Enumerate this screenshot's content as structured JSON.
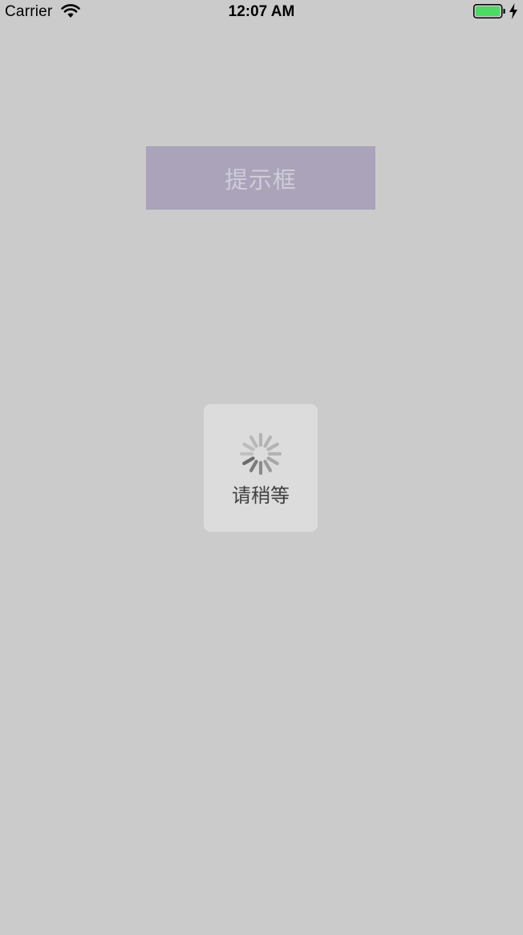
{
  "status_bar": {
    "carrier": "Carrier",
    "time": "12:07 AM",
    "wifi_icon": "wifi-icon",
    "battery_icon": "battery-icon",
    "charging_icon": "charging-bolt-icon",
    "battery_color": "#4cd964"
  },
  "main": {
    "prompt_button_label": "提示框",
    "prompt_button_color": "#aaa3ba"
  },
  "hud": {
    "spinner_icon": "activity-indicator-icon",
    "label": "请稍等"
  },
  "colors": {
    "background": "#cbcbcb",
    "hud_background": "#dcdcdc"
  }
}
